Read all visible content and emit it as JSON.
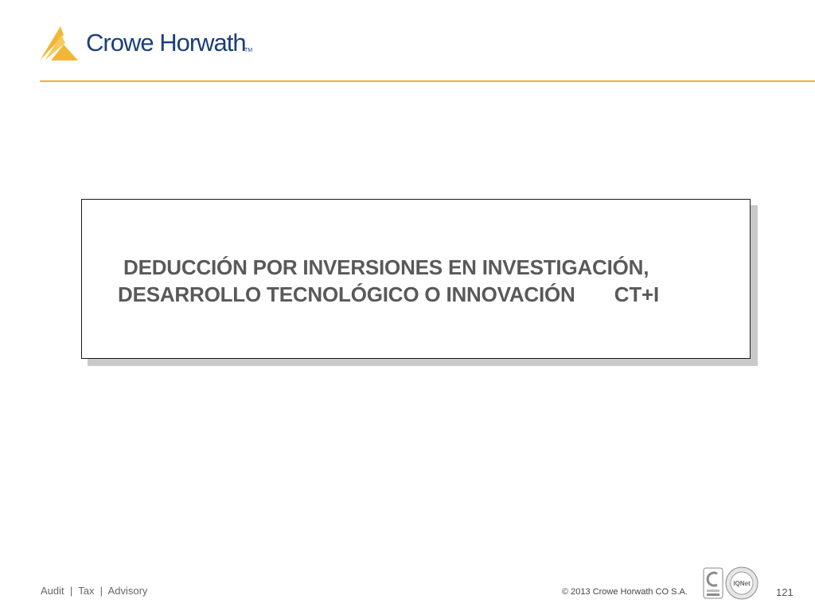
{
  "header": {
    "logo_text": "Crowe Horwath",
    "logo_tm": "TM",
    "accent_color": "#f2b636",
    "brand_color": "#1c3f7a"
  },
  "slide": {
    "title_line_1": "DEDUCCIÓN POR INVERSIONES EN INVESTIGACIÓN,",
    "title_line_2": "DESARROLLO TECNOLÓGICO O INNOVACIÓN       CT+I"
  },
  "footer": {
    "tagline": "Audit  |  Tax  |  Advisory",
    "copyright": "© 2013 Crowe Horwath CO S.A.",
    "cert_badge_label": "IQNet",
    "page_number": "121"
  }
}
